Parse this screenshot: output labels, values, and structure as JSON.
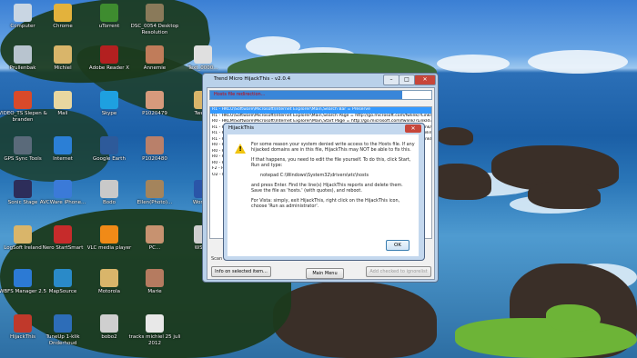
{
  "desktop_icons": [
    {
      "label": "Computer",
      "icon": "computer-icon",
      "color": "#c9d6e3"
    },
    {
      "label": "Chrome",
      "icon": "chrome-icon",
      "color": "#e3b23c"
    },
    {
      "label": "uTorrent",
      "icon": "utorrent-icon",
      "color": "#3e8c2f"
    },
    {
      "label": "DSC_0054 Desktop Resolution",
      "icon": "photo-icon",
      "color": "#8a7a5a"
    },
    {
      "label": "Prullenbak",
      "icon": "recycle-bin-icon",
      "color": "#b8c4cf"
    },
    {
      "label": "Michiel",
      "icon": "user-folder-icon",
      "color": "#d9b56a"
    },
    {
      "label": "Adobe Reader X",
      "icon": "adobe-reader-icon",
      "color": "#b32020"
    },
    {
      "label": "Annemie",
      "icon": "photo-icon",
      "color": "#c07c5a"
    },
    {
      "label": "Text_0000...",
      "icon": "text-file-icon",
      "color": "#dfdfdf"
    },
    {
      "label": "VIDEO_TS Slepen & branden",
      "icon": "dvd-icon",
      "color": "#d94a2a"
    },
    {
      "label": "Mail",
      "icon": "mail-icon",
      "color": "#e8d7a0"
    },
    {
      "label": "Skype",
      "icon": "skype-icon",
      "color": "#1ea0e0"
    },
    {
      "label": "P1020479",
      "icon": "photo-icon",
      "color": "#d69a7c"
    },
    {
      "label": "Twee...",
      "icon": "folder-icon",
      "color": "#d9b56a"
    },
    {
      "label": "GPS Sync Tools",
      "icon": "gps-icon",
      "color": "#5a6a7a"
    },
    {
      "label": "Internet",
      "icon": "internet-explorer-icon",
      "color": "#2b7fd6"
    },
    {
      "label": "Google Earth",
      "icon": "google-earth-icon",
      "color": "#2d5a9a"
    },
    {
      "label": "P1020480",
      "icon": "photo-icon",
      "color": "#b9806a"
    },
    {
      "label": "Sonic Stage",
      "icon": "music-icon",
      "color": "#2d2d5a"
    },
    {
      "label": "AVCWare iPhone...",
      "icon": "avcware-icon",
      "color": "#3b7ad8"
    },
    {
      "label": "Bodo",
      "icon": "document-icon",
      "color": "#c9c9c9"
    },
    {
      "label": "Ellen(Photo)...",
      "icon": "photo-icon",
      "color": "#a4845c"
    },
    {
      "label": "Words...",
      "icon": "word-icon",
      "color": "#2a55a8"
    },
    {
      "label": "LogSoft Ireland",
      "icon": "folder-icon",
      "color": "#d9b56a"
    },
    {
      "label": "Nero StartSmart",
      "icon": "nero-icon",
      "color": "#c62b2b"
    },
    {
      "label": "VLC media player",
      "icon": "vlc-icon",
      "color": "#f08a17"
    },
    {
      "label": "PC...",
      "icon": "photo-icon",
      "color": "#c79270"
    },
    {
      "label": "WSD...",
      "icon": "document-icon",
      "color": "#cfcfcf"
    },
    {
      "label": "WBFS Manager 2.5",
      "icon": "wbfs-icon",
      "color": "#2c7ad4"
    },
    {
      "label": "MapSource",
      "icon": "mapsource-icon",
      "color": "#2a8ac8"
    },
    {
      "label": "Motorola",
      "icon": "folder-icon",
      "color": "#d9b56a"
    },
    {
      "label": "Marie",
      "icon": "photo-icon",
      "color": "#b57b60"
    },
    {
      "label": "HijackThis",
      "icon": "hijackthis-icon",
      "color": "#c0392b"
    },
    {
      "label": "TuneUp 1-klik Onderhoud",
      "icon": "tuneup-icon",
      "color": "#2d6db8"
    },
    {
      "label": "bobo2",
      "icon": "document-icon",
      "color": "#cfcfcf"
    },
    {
      "label": "tracks michiel 25 juli 2012",
      "icon": "file-icon",
      "color": "#e8e8e8"
    }
  ],
  "main_window": {
    "title": "Trend Micro HijackThis - v2.0.4",
    "progress_text": "Hosts file redirection...",
    "progress": 0.87,
    "list_rows": [
      "R1 - HKCU\\Software\\Microsoft\\Internet Explorer\\Main,Search Bar = Preserve",
      "R1 - HKCU\\Software\\Microsoft\\Internet Explorer\\Main,Search Page = http://go.microsoft.com/fwlink/?LinkId=54896",
      "R0 - HKLM\\Software\\Microsoft\\Internet Explorer\\Main,Start Page = http://go.microsoft.com/fwlink/?LinkId=69157",
      "R1 - HKLM\\Software\\Microsoft\\Internet Explorer\\Main,Default_Page_URL = http://go.microsoft.com/fwlink/?LinkId=69157",
      "R1 - HKLM\\Software\\Microsoft\\Internet Explorer\\Main,Default_Search_URL = http://go.microsoft.com/fwlink/?LinkId=54896",
      "R1 - HKLM\\Software\\Microsoft\\Internet Explorer\\Main,Search Page = http://go.microsoft.com/fwlink/?LinkId=54896",
      "R0 - HKLM\\Software\\Microsoft\\Internet Explorer\\Search,SearchAssistant =",
      "R0 - HKLM\\Software\\Microsoft\\Internet Explorer\\Search,CustomizeSearch =",
      "R0 - HKLM\\Software\\Microsoft\\Internet Explorer\\Main,Local Page = C:\\Windows\\SysWOW64\\blank.htm",
      "R0 - HKCU\\Software\\Microsoft\\Internet Explorer\\Toolbar,LinksFolderName =",
      "F2 - REG:system.ini: UserInit=userinit.exe",
      "O2 - BHO: (no name) - {5C255C8A-E604-49b4-9D64-90988571CECB} - (no file)"
    ],
    "scan_label": "Scan & fix stuff",
    "info_button": "Info on selected item...",
    "main_menu_button": "Main Menu",
    "add_ignore_button": "Add checked to ignorelist"
  },
  "dialog": {
    "title": "HijackThis",
    "close_glyph": "✕",
    "warning_glyph": "!",
    "para1": "For some reason your system denied write access to the Hosts file. If any hijacked domains are in this file, HijackThis may NOT be able to fix this.",
    "para2": "If that happens, you need to edit the file yourself. To do this, click Start, Run and type:",
    "command": "notepad C:\\Windows\\System32\\drivers\\etc\\hosts",
    "para3": "and press Enter. Find the line(s) HijackThis reports and delete them. Save the file as 'hosts.' (with quotes), and reboot.",
    "para4": "For Vista: simply, exit HijackThis, right click on the HijackThis icon, choose 'Run as administrator'.",
    "ok_label": "OK"
  },
  "window_controls": {
    "minimize": "–",
    "maximize": "□",
    "close": "✕"
  }
}
